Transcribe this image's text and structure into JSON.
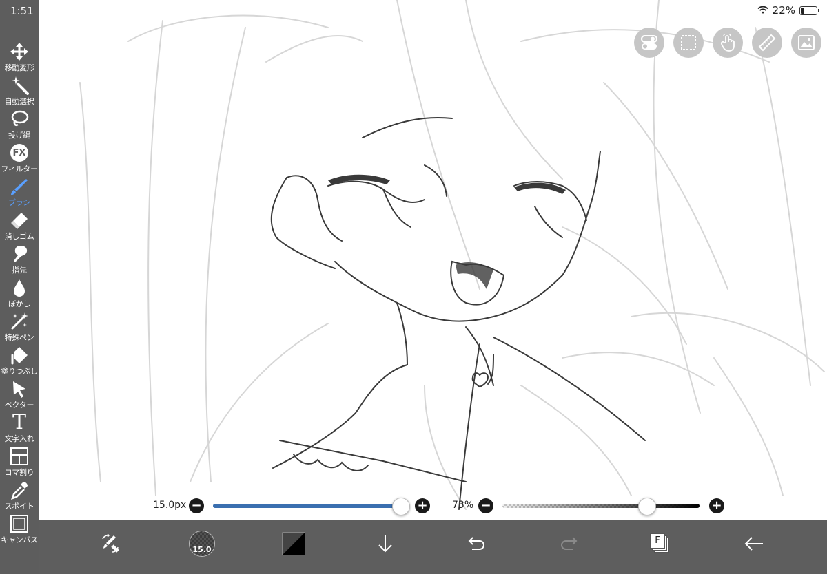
{
  "status": {
    "time": "1:51",
    "battery_text": "22%",
    "battery_level": 0.22
  },
  "sidebar": {
    "items": [
      {
        "label": "移動変形",
        "icon": "move-icon",
        "active": false
      },
      {
        "label": "自動選択",
        "icon": "magic-wand-icon",
        "active": false
      },
      {
        "label": "投げ縄",
        "icon": "lasso-icon",
        "active": false
      },
      {
        "label": "フィルター",
        "icon": "fx-icon",
        "active": false
      },
      {
        "label": "ブラシ",
        "icon": "brush-icon",
        "active": true
      },
      {
        "label": "消しゴム",
        "icon": "eraser-icon",
        "active": false
      },
      {
        "label": "指先",
        "icon": "smudge-icon",
        "active": false
      },
      {
        "label": "ぼかし",
        "icon": "blur-drop-icon",
        "active": false
      },
      {
        "label": "特殊ペン",
        "icon": "special-pen-icon",
        "active": false
      },
      {
        "label": "塗りつぶし",
        "icon": "fill-bucket-icon",
        "active": false
      },
      {
        "label": "ベクター",
        "icon": "vector-arrow-icon",
        "active": false
      },
      {
        "label": "文字入れ",
        "icon": "text-icon",
        "active": false
      },
      {
        "label": "コマ割り",
        "icon": "frame-divider-icon",
        "active": false
      },
      {
        "label": "スポイト",
        "icon": "eyedropper-icon",
        "active": false
      },
      {
        "label": "キャンバス",
        "icon": "canvas-icon",
        "active": false
      }
    ],
    "fx_text": "FX",
    "text_glyph": "T"
  },
  "top_buttons": [
    {
      "icon": "toggle-settings-icon"
    },
    {
      "icon": "selection-icon"
    },
    {
      "icon": "touch-hand-icon"
    },
    {
      "icon": "ruler-icon"
    },
    {
      "icon": "image-material-icon"
    }
  ],
  "brush_size": {
    "label": "15.0px",
    "value": 15.0,
    "level": 0.95,
    "color": "#3a6fb0"
  },
  "opacity": {
    "label": "73%",
    "value": 73
  },
  "bottom_bar": {
    "brush_size_badge": "15.0",
    "layer_letter": "F",
    "items": [
      {
        "icon": "swap-brush-eraser-icon"
      },
      {
        "icon": "brush-size-indicator"
      },
      {
        "icon": "color-swatch-icon"
      },
      {
        "icon": "move-down-arrow-icon"
      },
      {
        "icon": "undo-icon"
      },
      {
        "icon": "redo-icon"
      },
      {
        "icon": "layers-icon"
      },
      {
        "icon": "back-arrow-icon"
      }
    ]
  },
  "colors": {
    "sidebar_bg": "#5d5d5d",
    "bottom_bg": "#5e5e5e",
    "active_tool": "#5aa0ff",
    "button_bg": "#c6c6c6"
  }
}
